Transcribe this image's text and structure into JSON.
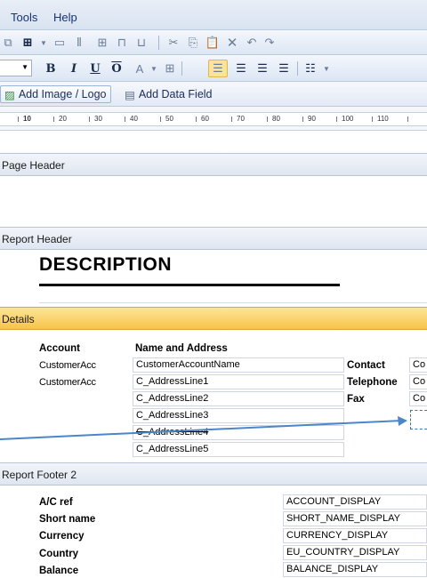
{
  "menu": {
    "tools": "Tools",
    "help": "Help"
  },
  "toolbar": {
    "add_image": "Add Image / Logo",
    "add_field": "Add Data Field"
  },
  "ruler": {
    "labels": [
      "10",
      "20",
      "30",
      "40",
      "50",
      "60",
      "70",
      "80",
      "90",
      "100",
      "110"
    ]
  },
  "sections": {
    "page_header": "Page Header",
    "report_header": "Report Header",
    "details": "Details",
    "report_footer": "Report Footer 2"
  },
  "report_header": {
    "title": "DESCRIPTION"
  },
  "details": {
    "account_header": "Account",
    "name_header": "Name and Address",
    "account_fields": [
      "CustomerAcc",
      "CustomerAcc"
    ],
    "address_fields": [
      "CustomerAccountName",
      "C_AddressLine1",
      "C_AddressLine2",
      "C_AddressLine3",
      "C_AddressLine4",
      "C_AddressLine5"
    ],
    "contact_labels": [
      "Contact",
      "Telephone",
      "Fax"
    ],
    "contact_fields": [
      "Co",
      "Co",
      "Co"
    ]
  },
  "footer": {
    "labels": [
      "A/C ref",
      "Short name",
      "Currency",
      "Country",
      "Balance"
    ],
    "values": [
      "ACCOUNT_DISPLAY",
      "SHORT_NAME_DISPLAY",
      "CURRENCY_DISPLAY",
      "EU_COUNTRY_DISPLAY",
      "BALANCE_DISPLAY"
    ]
  },
  "colors": {
    "accent": "#3a6fb4",
    "details_band": "#f6c448",
    "menu_text": "#15337a"
  }
}
